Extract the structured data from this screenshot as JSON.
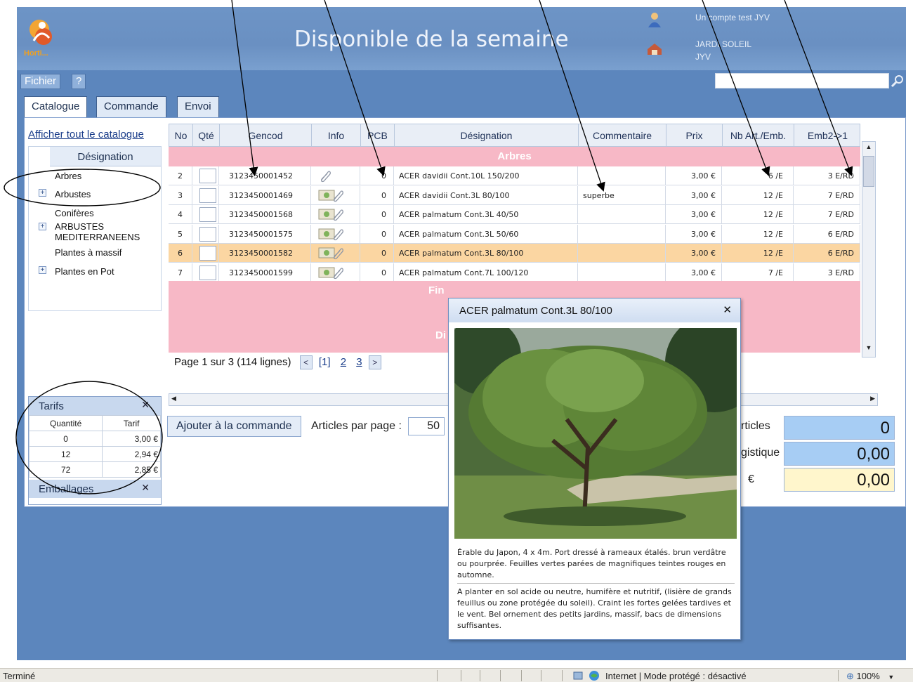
{
  "header": {
    "title": "Disponible de la semaine",
    "logo_text": "Horti...",
    "user_line1": "Un compte test JYV",
    "user_line2": "JARDI SOLEIL",
    "user_line3": "JYV"
  },
  "menu": {
    "file": "Fichier",
    "help": "?"
  },
  "search": {
    "placeholder": ""
  },
  "tabs": [
    "Catalogue",
    "Commande",
    "Envoi"
  ],
  "sidebar": {
    "show_all_link": "Afficher tout le catalogue",
    "tree_header": "Désignation",
    "items": [
      "Arbres",
      "Arbustes",
      "Conifères",
      "ARBUSTES MEDITERRANEENS",
      "Plantes à massif",
      "Plantes en Pot"
    ]
  },
  "grid": {
    "columns": [
      "No",
      "Qté",
      "Gencod",
      "Info",
      "PCB",
      "Désignation",
      "Commentaire",
      "Prix",
      "Nb Art./Emb.",
      "Emb2->1"
    ],
    "group_top": "Arbres",
    "group_bottom_1": "Fin",
    "group_bottom_2": "Di",
    "rows": [
      {
        "no": "2",
        "gencod": "3123450001452",
        "pcb": "0",
        "designation": "ACER davidii Cont.10L 150/200",
        "comment": "",
        "price": "3,00 €",
        "nb": "6 /E",
        "emb": "3 E/RD"
      },
      {
        "no": "3",
        "gencod": "3123450001469",
        "pcb": "0",
        "designation": "ACER davidii Cont.3L 80/100",
        "comment": "superbe",
        "price": "3,00 €",
        "nb": "12 /E",
        "emb": "7 E/RD"
      },
      {
        "no": "4",
        "gencod": "3123450001568",
        "pcb": "0",
        "designation": "ACER palmatum Cont.3L 40/50",
        "comment": "",
        "price": "3,00 €",
        "nb": "12 /E",
        "emb": "7 E/RD"
      },
      {
        "no": "5",
        "gencod": "3123450001575",
        "pcb": "0",
        "designation": "ACER palmatum Cont.3L 50/60",
        "comment": "",
        "price": "3,00 €",
        "nb": "12 /E",
        "emb": "6 E/RD"
      },
      {
        "no": "6",
        "gencod": "3123450001582",
        "pcb": "0",
        "designation": "ACER palmatum Cont.3L 80/100",
        "comment": "",
        "price": "3,00 €",
        "nb": "12 /E",
        "emb": "6 E/RD"
      },
      {
        "no": "7",
        "gencod": "3123450001599",
        "pcb": "0",
        "designation": "ACER palmatum Cont.7L 100/120",
        "comment": "",
        "price": "3,00 €",
        "nb": "7 /E",
        "emb": "3 E/RD"
      }
    ]
  },
  "pager": {
    "text": "Page 1 sur 3 (114 lignes)",
    "current": "[1]",
    "p2": "2",
    "p3": "3",
    "prev": "<",
    "next": ">"
  },
  "tarifs": {
    "title": "Tarifs",
    "col_qty": "Quantité",
    "col_price": "Tarif",
    "rows": [
      {
        "qty": "0",
        "price": "3,00 €"
      },
      {
        "qty": "12",
        "price": "2,94 €"
      },
      {
        "qty": "72",
        "price": "2,85 €"
      }
    ]
  },
  "emballages": {
    "title": "Emballages"
  },
  "actions": {
    "add_to_order": "Ajouter à la commande",
    "per_page_label": "Articles par page :",
    "per_page_value": "50"
  },
  "totals": {
    "articles_label": "rticles",
    "articles_value": "0",
    "logistique_label": "gistique",
    "logistique_value": "0,00",
    "euro_label": "€",
    "euro_value": "0,00"
  },
  "popup": {
    "title": "ACER palmatum Cont.3L 80/100",
    "desc1": "Érable du Japon, 4 x 4m. Port dressé à rameaux étalés. brun verdâtre ou pourprée. Feuilles vertes parées de magnifiques teintes rouges en automne.",
    "desc2": "A planter en sol acide ou neutre, humifère et nutritif, (lisière de grands feuillus ou zone protégée du soleil). Craint les fortes gelées tardives et le vent. Bel ornement des petits jardins, massif, bacs de dimensions suffisantes."
  },
  "statusbar": {
    "left": "Terminé",
    "zone": "Internet | Mode protégé : désactivé",
    "zoom": "100%"
  },
  "icons": {
    "user": "user-icon",
    "shop": "shop-icon",
    "search": "magnifier-icon",
    "attach": "paperclip-icon",
    "photo": "photo-icon",
    "globe": "globe-icon"
  }
}
